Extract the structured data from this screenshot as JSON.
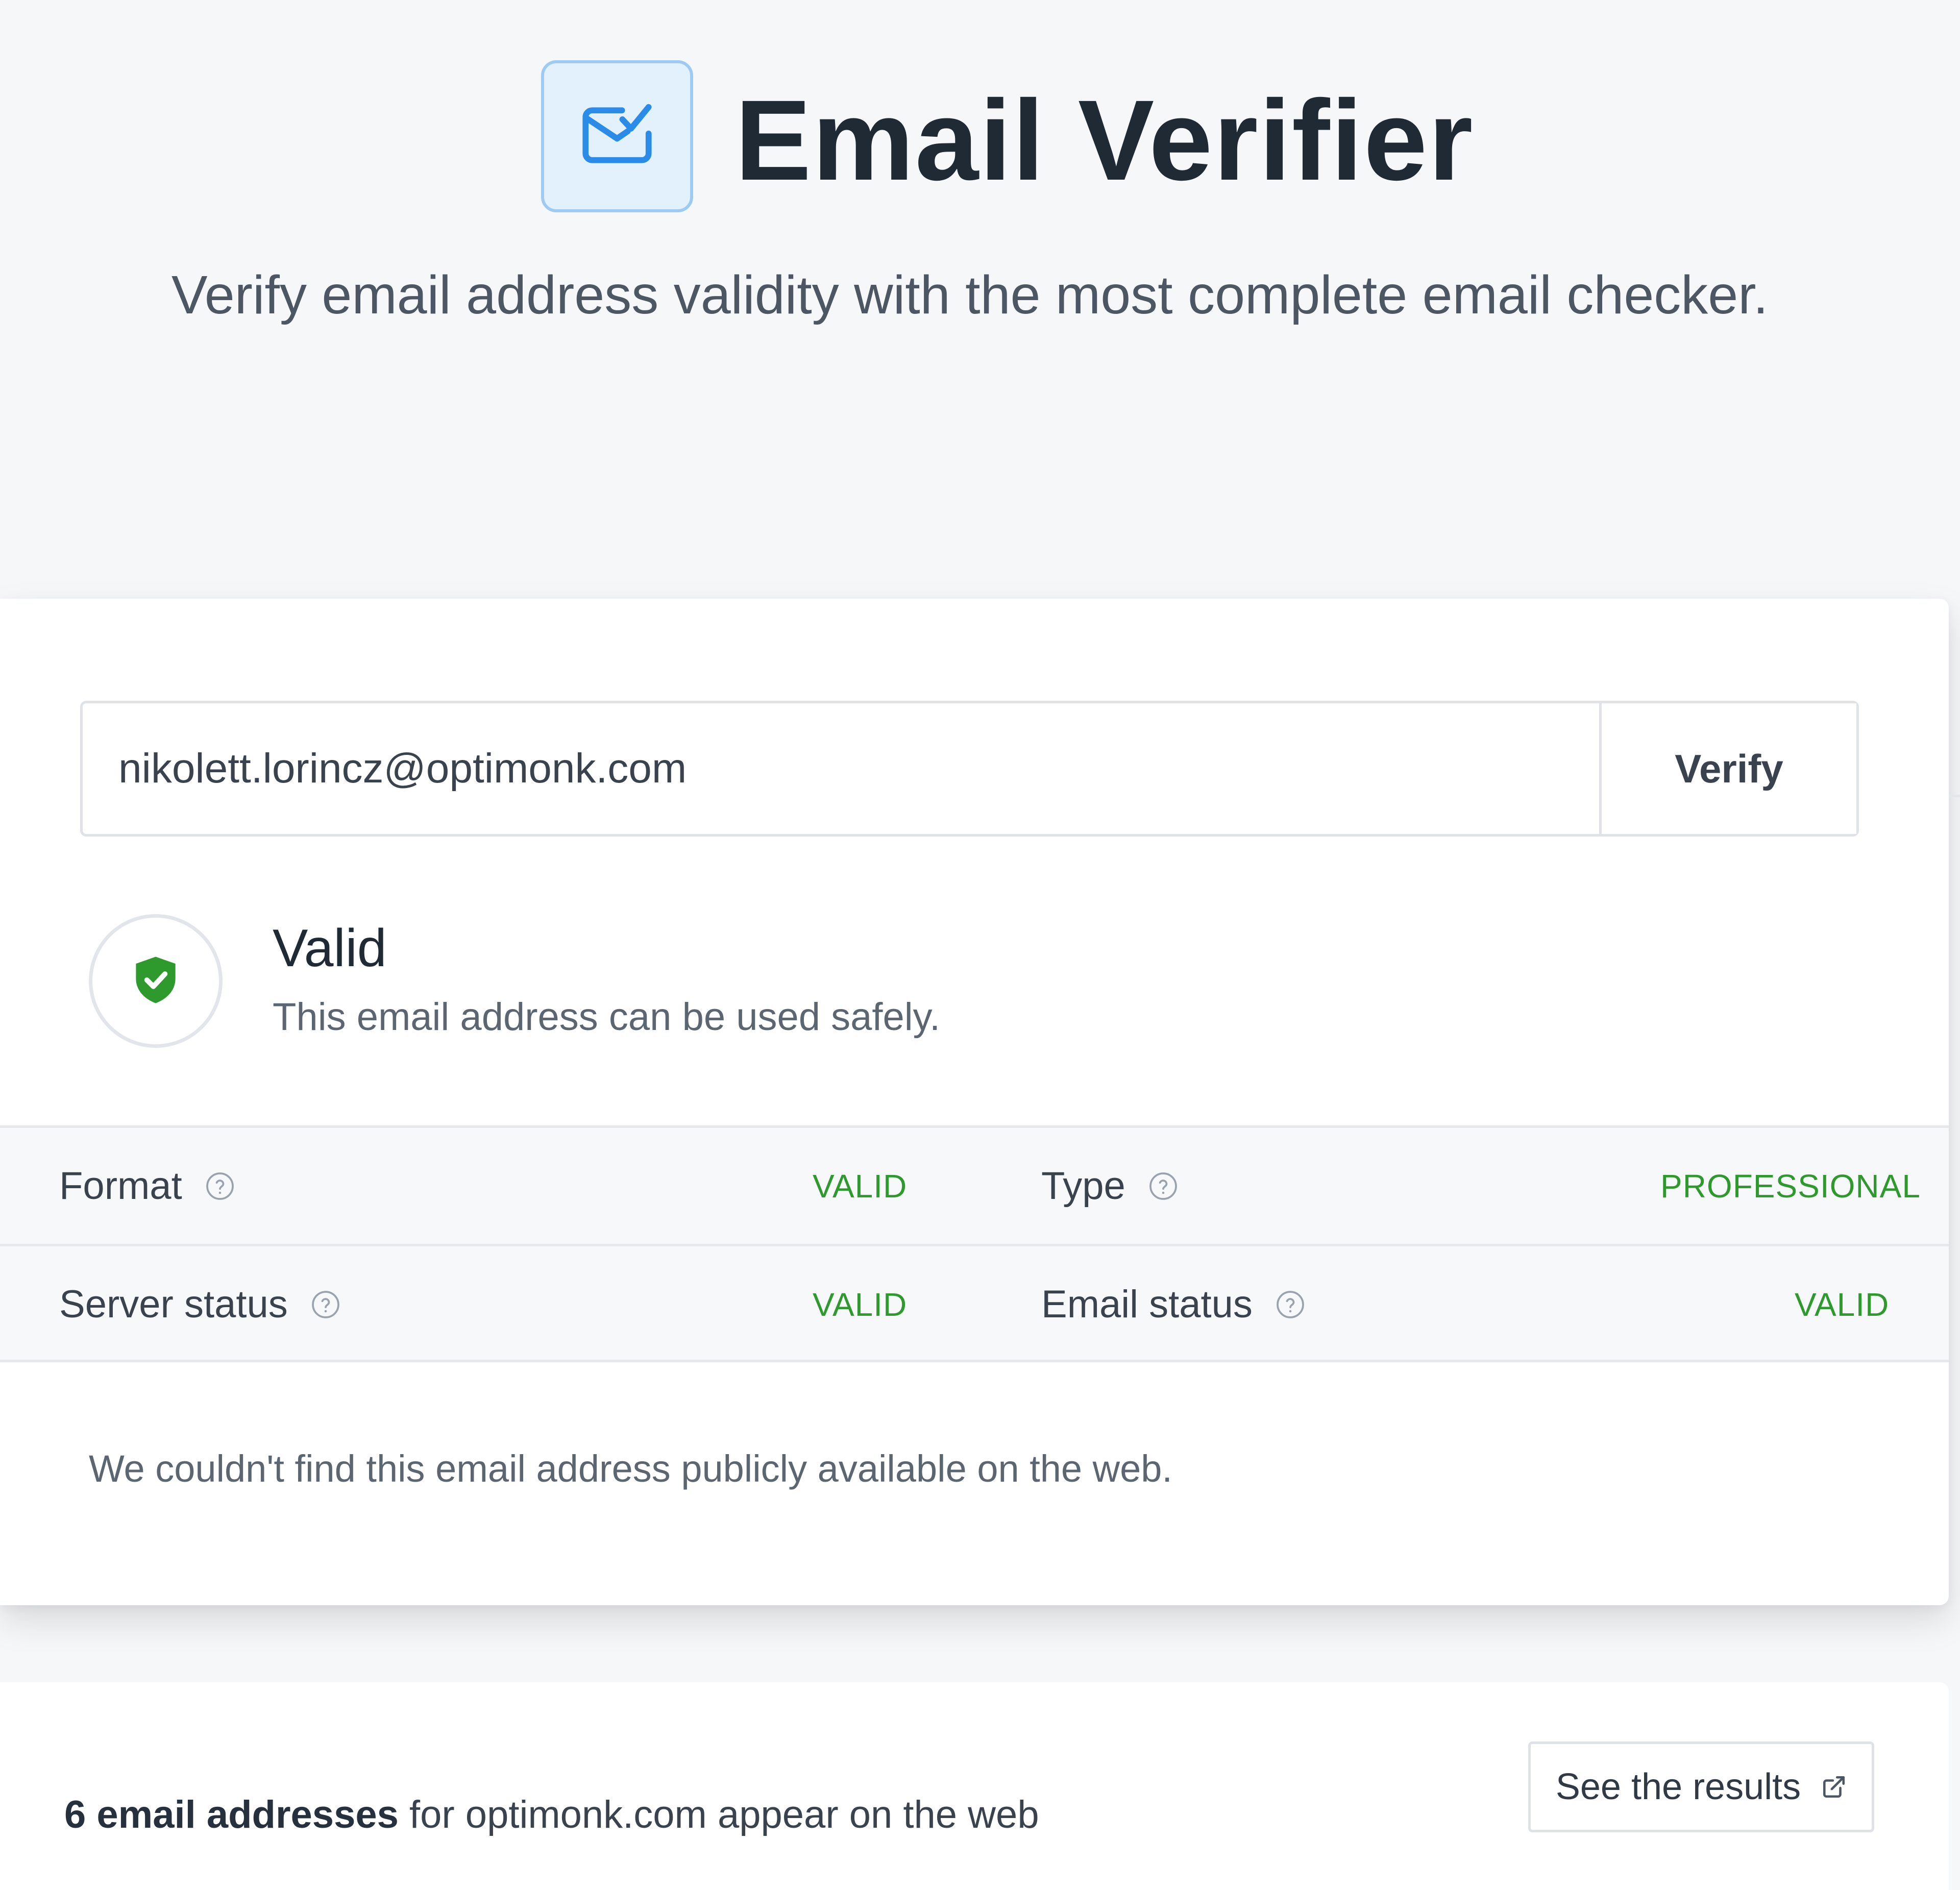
{
  "header": {
    "title": "Email Verifier",
    "subtitle": "Verify email address validity with the most complete email checker.",
    "logo_icon": "envelope-check-icon",
    "logo_color": "#2a8ce8"
  },
  "search": {
    "value": "nikolett.lorincz@optimonk.com",
    "verify_label": "Verify"
  },
  "result": {
    "status_icon": "shield-check-icon",
    "status_color": "#2e9a2e",
    "title": "Valid",
    "description": "This email address can be used safely."
  },
  "details": {
    "format": {
      "label": "Format",
      "value": "VALID"
    },
    "type": {
      "label": "Type",
      "value": "PROFESSIONAL"
    },
    "server_status": {
      "label": "Server status",
      "value": "VALID"
    },
    "email_status": {
      "label": "Email status",
      "value": "VALID"
    }
  },
  "web_note": "We couldn't find this email address publicly available on the web.",
  "domain_results": {
    "count_text": "6 email addresses",
    "rest_text": " for optimonk.com appear on the web",
    "button_label": "See the results",
    "button_icon": "external-link-icon"
  }
}
